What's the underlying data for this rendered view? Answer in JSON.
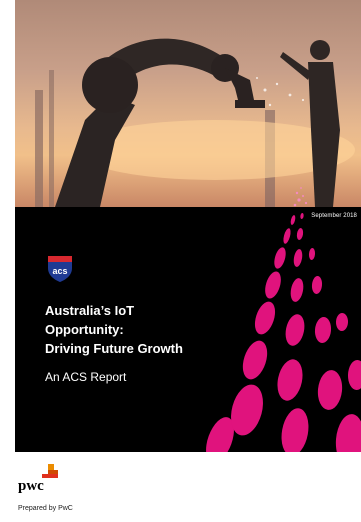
{
  "cover": {
    "date": "September 2018",
    "logo_text": "acs",
    "title_lines": [
      "Australia’s IoT",
      "Opportunity:",
      "Driving Future Growth"
    ],
    "subtitle": "An ACS Report"
  },
  "footer": {
    "brand": "pwc",
    "prepared_by": "Prepared by PwC"
  },
  "colors": {
    "accent_magenta": "#e0137d",
    "pwc_orange": "#d04a02",
    "acs_blue": "#1f3a93",
    "acs_red": "#d7282f"
  },
  "icons": [
    "acs-logo-icon",
    "pwc-logo-icon"
  ]
}
